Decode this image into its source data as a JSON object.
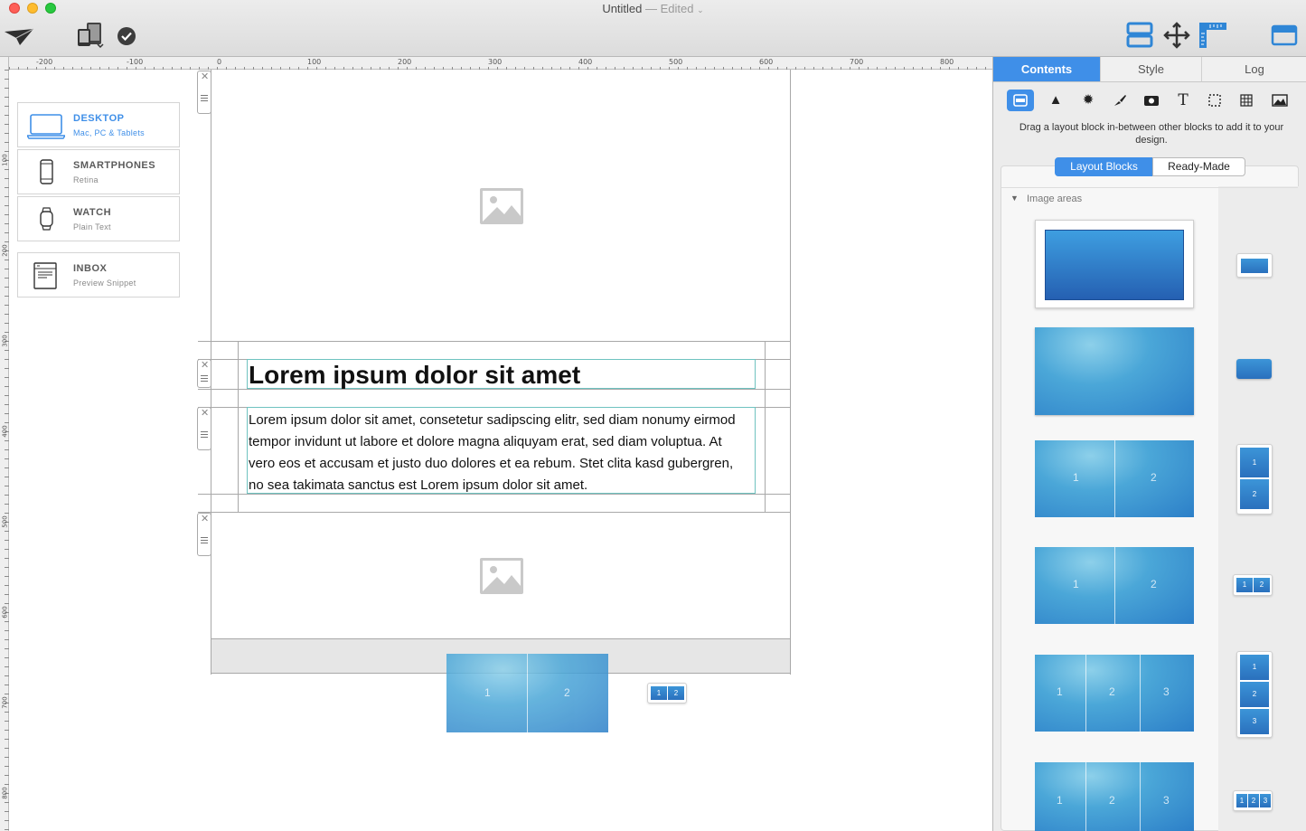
{
  "window": {
    "title": "Untitled",
    "status": "— Edited"
  },
  "toolbar": {
    "left_icons": [
      "paper-plane-icon",
      "devices-icon",
      "checkmark-icon"
    ],
    "right_icons": [
      "layout-blocks-icon",
      "move-arrows-icon",
      "ruler-icon",
      "sidebar-icon"
    ]
  },
  "ruler": {
    "h_labels": [
      "-200",
      "-100",
      "0",
      "100",
      "200",
      "300",
      "400",
      "500",
      "600",
      "700",
      "800"
    ],
    "v_labels": [
      "100",
      "200",
      "300",
      "400",
      "500",
      "600",
      "700",
      "800"
    ]
  },
  "devices": [
    {
      "title": "DESKTOP",
      "subtitle": "Mac, PC & Tablets",
      "icon": "laptop-icon",
      "selected": true
    },
    {
      "title": "SMARTPHONES",
      "subtitle": "Retina",
      "icon": "smartphone-icon",
      "selected": false
    },
    {
      "title": "WATCH",
      "subtitle": "Plain Text",
      "icon": "watch-icon",
      "selected": false
    },
    {
      "title": "INBOX",
      "subtitle": "Preview Snippet",
      "icon": "inbox-icon",
      "selected": false
    }
  ],
  "canvas": {
    "heading": "Lorem ipsum dolor sit amet",
    "body": "Lorem ipsum dolor sit amet, consetetur sadipscing elitr, sed diam nonumy eirmod tempor invidunt ut labore et dolore magna aliquyam erat, sed diam voluptua. At vero eos et accusam et justo duo dolores et ea rebum. Stet clita kasd gubergren, no sea takimata sanctus est Lorem ipsum dolor sit amet.",
    "drag_preview_labels": [
      "1",
      "2"
    ]
  },
  "panel": {
    "tabs": [
      "Contents",
      "Style",
      "Log"
    ],
    "active_tab": "Contents",
    "tools": [
      "layout-block-icon",
      "triangle-icon",
      "badge-icon",
      "brush-icon",
      "camera-icon",
      "text-icon",
      "selection-icon",
      "pattern-icon",
      "image-icon"
    ],
    "text_tool_label": "T",
    "hint": "Drag a layout block in-between other blocks to add it to your design.",
    "segments": [
      "Layout Blocks",
      "Ready-Made"
    ],
    "active_segment": "Layout Blocks",
    "section_title": "Image areas",
    "blocks": [
      {
        "labels": []
      },
      {
        "labels": []
      },
      {
        "labels": [
          "1",
          "2"
        ]
      },
      {
        "labels": [
          "1",
          "2"
        ]
      },
      {
        "labels": [
          "1",
          "2",
          "3"
        ]
      },
      {
        "labels": [
          "1",
          "2",
          "3"
        ]
      }
    ]
  },
  "colors": {
    "accent": "#3f8fe8",
    "tile": "#2c7fc8",
    "teal_guide": "#6fc3c0"
  }
}
